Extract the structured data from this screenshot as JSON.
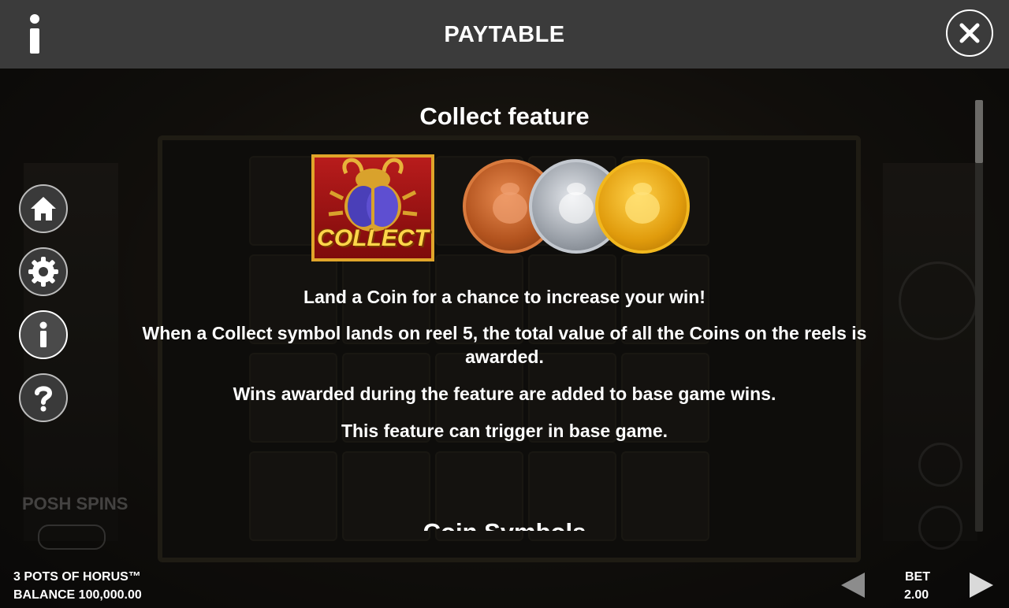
{
  "header": {
    "title": "PAYTABLE",
    "info_icon": "info-icon",
    "close_icon": "close-icon"
  },
  "side_menu": [
    {
      "icon": "home-icon"
    },
    {
      "icon": "gear-icon"
    },
    {
      "icon": "info-icon",
      "active": true
    },
    {
      "icon": "question-icon"
    }
  ],
  "content": {
    "section_title": "Collect feature",
    "collect_symbol_text": "COLLECT",
    "coins": [
      {
        "name": "bronze",
        "color": "#c8652e"
      },
      {
        "name": "silver",
        "color": "#a9adb3"
      },
      {
        "name": "gold",
        "color": "#e2a417"
      }
    ],
    "paragraphs": [
      "Land a Coin for a chance to increase your win!",
      "When a Collect symbol lands on reel 5, the total value of all the Coins on the reels is awarded.",
      "Wins awarded during the feature are added to base game wins.",
      "This feature can trigger in base game."
    ],
    "next_section_title": "Coin Symbols"
  },
  "background": {
    "posh_spins": "POSH SPINS"
  },
  "footer": {
    "game_name": "3 POTS OF HORUS™",
    "balance": "BALANCE 100,000.00",
    "bet_label": "BET",
    "bet_value": "2.00"
  },
  "colors": {
    "header_bg": "#3b3b3b",
    "text": "#ffffff",
    "accent_gold": "#e0a52a"
  }
}
